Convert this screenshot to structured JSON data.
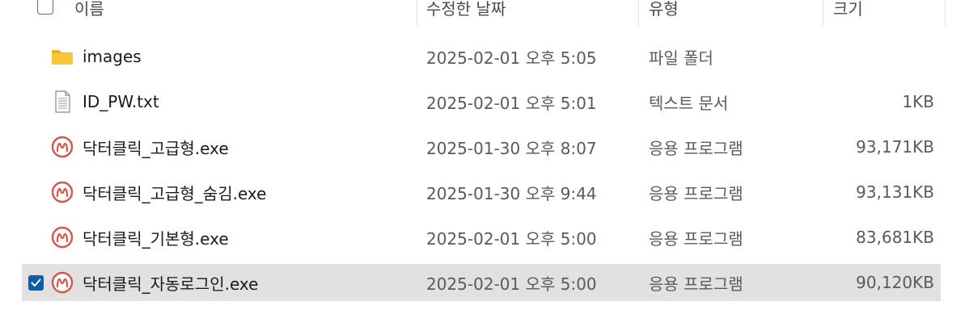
{
  "header": {
    "col_name": "이름",
    "col_date": "수정한 날짜",
    "col_type": "유형",
    "col_size": "크기"
  },
  "files": [
    {
      "name": "images",
      "date": "2025-02-01 오후 5:05",
      "type": "파일 폴더",
      "size": "",
      "icon": "folder-icon",
      "selected": false
    },
    {
      "name": "ID_PW.txt",
      "date": "2025-02-01 오후 5:01",
      "type": "텍스트 문서",
      "size": "1KB",
      "icon": "text-document-icon",
      "selected": false
    },
    {
      "name": "닥터클릭_고급형.exe",
      "date": "2025-01-30 오후 8:07",
      "type": "응용 프로그램",
      "size": "93,171KB",
      "icon": "app-icon",
      "selected": false
    },
    {
      "name": "닥터클릭_고급형_숨김.exe",
      "date": "2025-01-30 오후 9:44",
      "type": "응용 프로그램",
      "size": "93,131KB",
      "icon": "app-icon",
      "selected": false
    },
    {
      "name": "닥터클릭_기본형.exe",
      "date": "2025-02-01 오후 5:00",
      "type": "응용 프로그램",
      "size": "83,681KB",
      "icon": "app-icon",
      "selected": false
    },
    {
      "name": "닥터클릭_자동로그인.exe",
      "date": "2025-02-01 오후 5:00",
      "type": "응용 프로그램",
      "size": "90,120KB",
      "icon": "app-icon",
      "selected": true
    }
  ],
  "colors": {
    "selection_bg": "#e1e1e1",
    "checkbox_accent": "#0b5cad",
    "folder_yellow": "#f8c837",
    "app_icon_red": "#d9534f"
  }
}
